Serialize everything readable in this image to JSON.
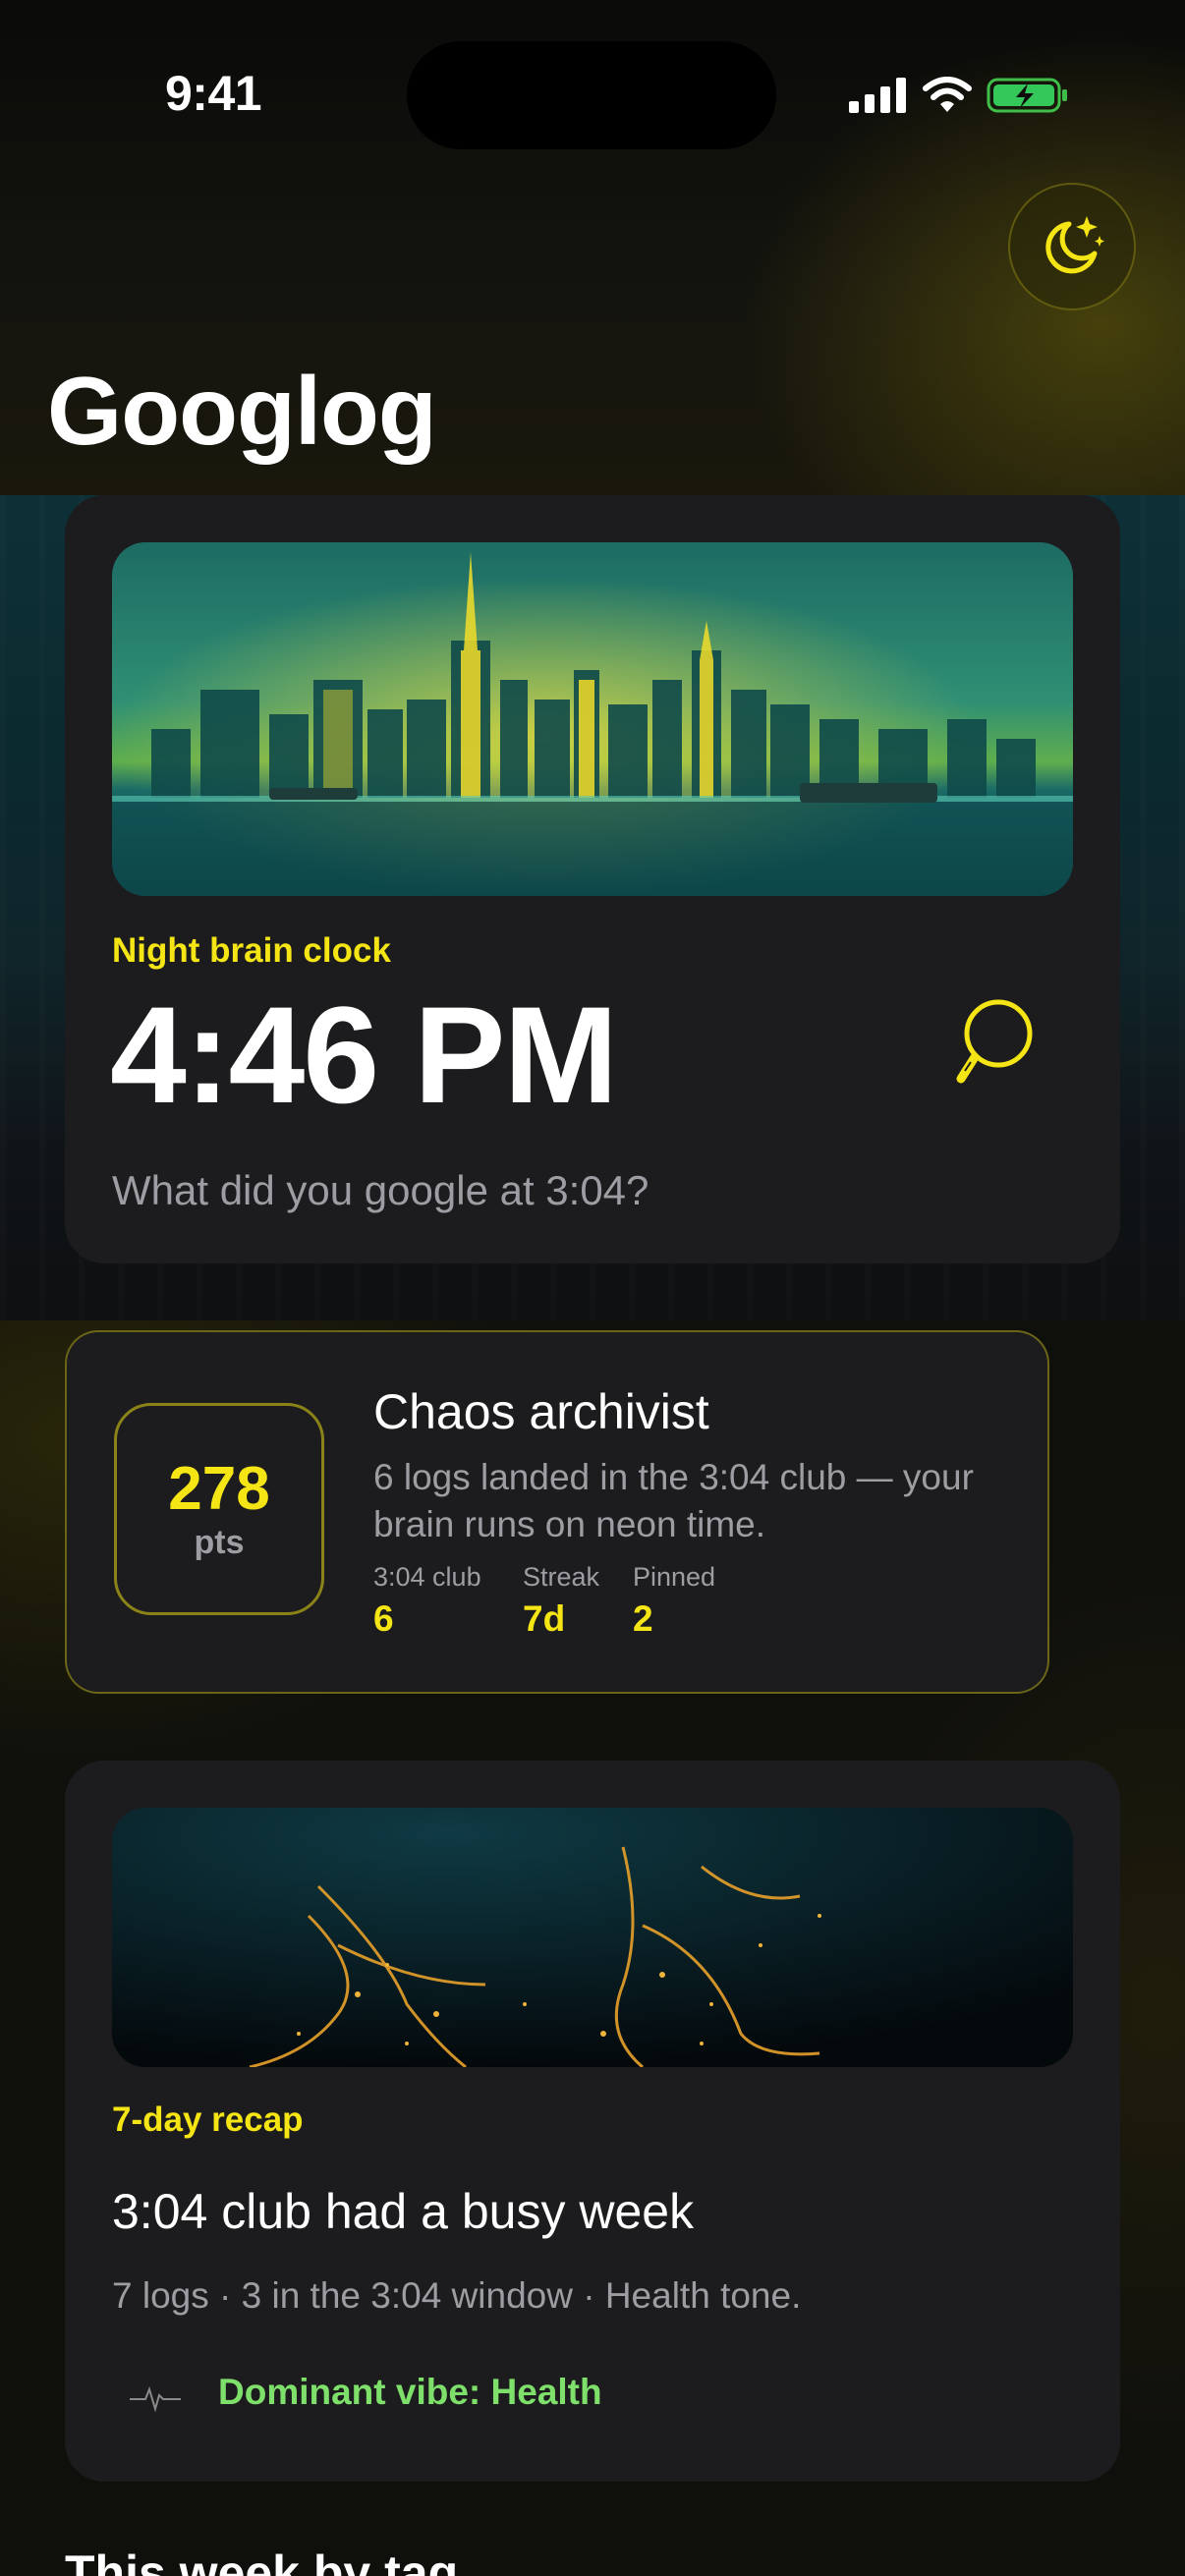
{
  "status_bar": {
    "time": "9:41"
  },
  "header": {
    "title": "Googlog",
    "mode_icon": "moon-stars-icon"
  },
  "clock_card": {
    "eyebrow": "Night brain clock",
    "time": "4:46 PM",
    "prompt": "What did you google at 3:04?",
    "hero_image": "neon-city-skyline",
    "icon": "magnifier-icon"
  },
  "score_card": {
    "points": "278",
    "points_label": "pts",
    "title": "Chaos archivist",
    "description": "6 logs landed in the 3:04 club — your brain runs on neon time.",
    "stats": [
      {
        "label": "3:04 club",
        "value": "6"
      },
      {
        "label": "Streak",
        "value": "7d"
      },
      {
        "label": "Pinned",
        "value": "2"
      }
    ]
  },
  "recap_card": {
    "eyebrow": "7-day recap",
    "title": "3:04 club had a busy week",
    "summary": "7 logs · 3 in the 3:04 window · Health tone.",
    "vibe": "Dominant vibe: Health",
    "hero_image": "glowing-particles",
    "vibe_icon": "pulse-icon"
  },
  "section": {
    "title": "This week by tag"
  },
  "colors": {
    "accent": "#f5e514",
    "health": "#7ee06a",
    "card": "#1c1c1e",
    "muted": "#9d9da3"
  }
}
